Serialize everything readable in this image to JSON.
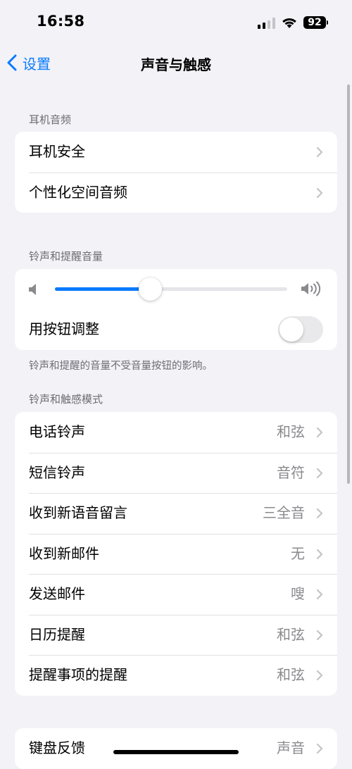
{
  "status_bar": {
    "time": "16:58",
    "battery_level": "92",
    "icons": [
      "signal-icon",
      "wifi-icon",
      "battery-icon"
    ]
  },
  "nav": {
    "back_label": "设置",
    "title": "声音与触感"
  },
  "headphone_audio": {
    "header": "耳机音频",
    "rows": [
      {
        "label": "耳机安全"
      },
      {
        "label": "个性化空间音频"
      }
    ]
  },
  "ringer": {
    "header": "铃声和提醒音量",
    "slider_fraction": 0.41,
    "toggle_label": "用按钮调整",
    "toggle_on": false,
    "footer": "铃声和提醒的音量不受音量按钮的影响。"
  },
  "sounds": {
    "header": "铃声和触感模式",
    "rows": [
      {
        "label": "电话铃声",
        "value": "和弦"
      },
      {
        "label": "短信铃声",
        "value": "音符"
      },
      {
        "label": "收到新语音留言",
        "value": "三全音"
      },
      {
        "label": "收到新邮件",
        "value": "无"
      },
      {
        "label": "发送邮件",
        "value": "嗖"
      },
      {
        "label": "日历提醒",
        "value": "和弦"
      },
      {
        "label": "提醒事项的提醒",
        "value": "和弦"
      }
    ]
  },
  "keyboard": {
    "rows": [
      {
        "label": "键盘反馈",
        "value": "声音"
      }
    ]
  },
  "colors": {
    "accent": "#0a7aff",
    "background": "#f2f2f7",
    "secondary_text": "#8a8a8e"
  }
}
